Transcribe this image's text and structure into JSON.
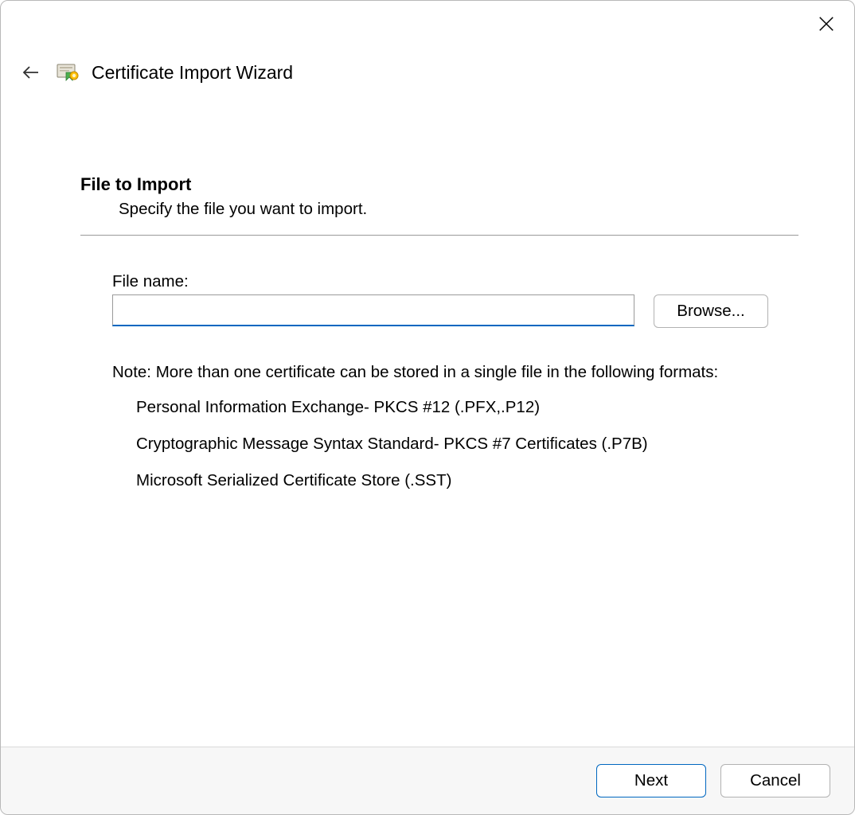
{
  "header": {
    "title": "Certificate Import Wizard"
  },
  "section": {
    "title": "File to Import",
    "subtitle": "Specify the file you want to import."
  },
  "form": {
    "file_label": "File name:",
    "file_value": "",
    "browse_label": "Browse...",
    "note": "Note:  More than one certificate can be stored in a single file in the following formats:",
    "formats": [
      "Personal Information Exchange- PKCS #12 (.PFX,.P12)",
      "Cryptographic Message Syntax Standard- PKCS #7 Certificates (.P7B)",
      "Microsoft Serialized Certificate Store (.SST)"
    ]
  },
  "footer": {
    "next_label": "Next",
    "cancel_label": "Cancel"
  }
}
